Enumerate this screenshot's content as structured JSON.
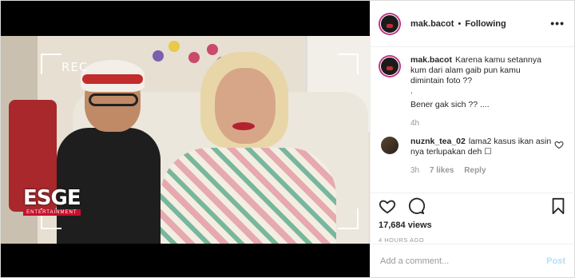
{
  "media": {
    "rec_label": "REC",
    "watermark_main": "ESGE",
    "watermark_sub": "ENTERTAINMENT"
  },
  "header": {
    "username": "mak.bacot",
    "separator": "•",
    "follow_status": "Following",
    "more": "•••"
  },
  "caption": {
    "username": "mak.bacot",
    "lines": [
      "Karena kamu setannya",
      "kum dari alam gaib pun kamu",
      "dimintain foto ??",
      ".",
      "Bener gak sich ?? ...."
    ],
    "time": "4h"
  },
  "comment": {
    "username": "nuznk_tea_02",
    "text": "lama2 kasus ikan asin nya terlupakan deh ☐",
    "time": "3h",
    "likes": "7 likes",
    "reply": "Reply"
  },
  "actions": {
    "views": "17,684 views",
    "time": "4 HOURS AGO"
  },
  "add_comment": {
    "placeholder": "Add a comment...",
    "post_label": "Post"
  },
  "colors": {
    "border": "#dbdbdb",
    "muted": "#999999",
    "post_disabled": "#b2dffc",
    "text": "#262626"
  }
}
